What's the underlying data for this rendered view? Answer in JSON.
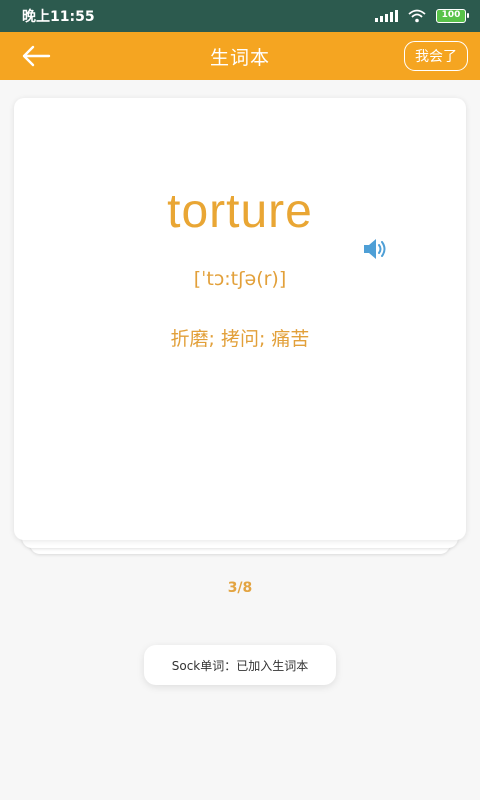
{
  "status_bar": {
    "time": "晚上11:55",
    "battery_level": "100",
    "battery_color": "#58c24a"
  },
  "app_bar": {
    "title": "生词本",
    "back_icon": "arrow-left-icon",
    "known_button_label": "我会了",
    "background_color": "#f5a521"
  },
  "card": {
    "word": "torture",
    "phonetic": "[ˈtɔ:tʃə(r)]",
    "meaning": "折磨; 拷问; 痛苦",
    "speaker_icon": "speaker-icon",
    "text_color": "#e9a634"
  },
  "pager": {
    "counter": "3/8"
  },
  "toast": {
    "message": "Sock单词：已加入生词本"
  }
}
